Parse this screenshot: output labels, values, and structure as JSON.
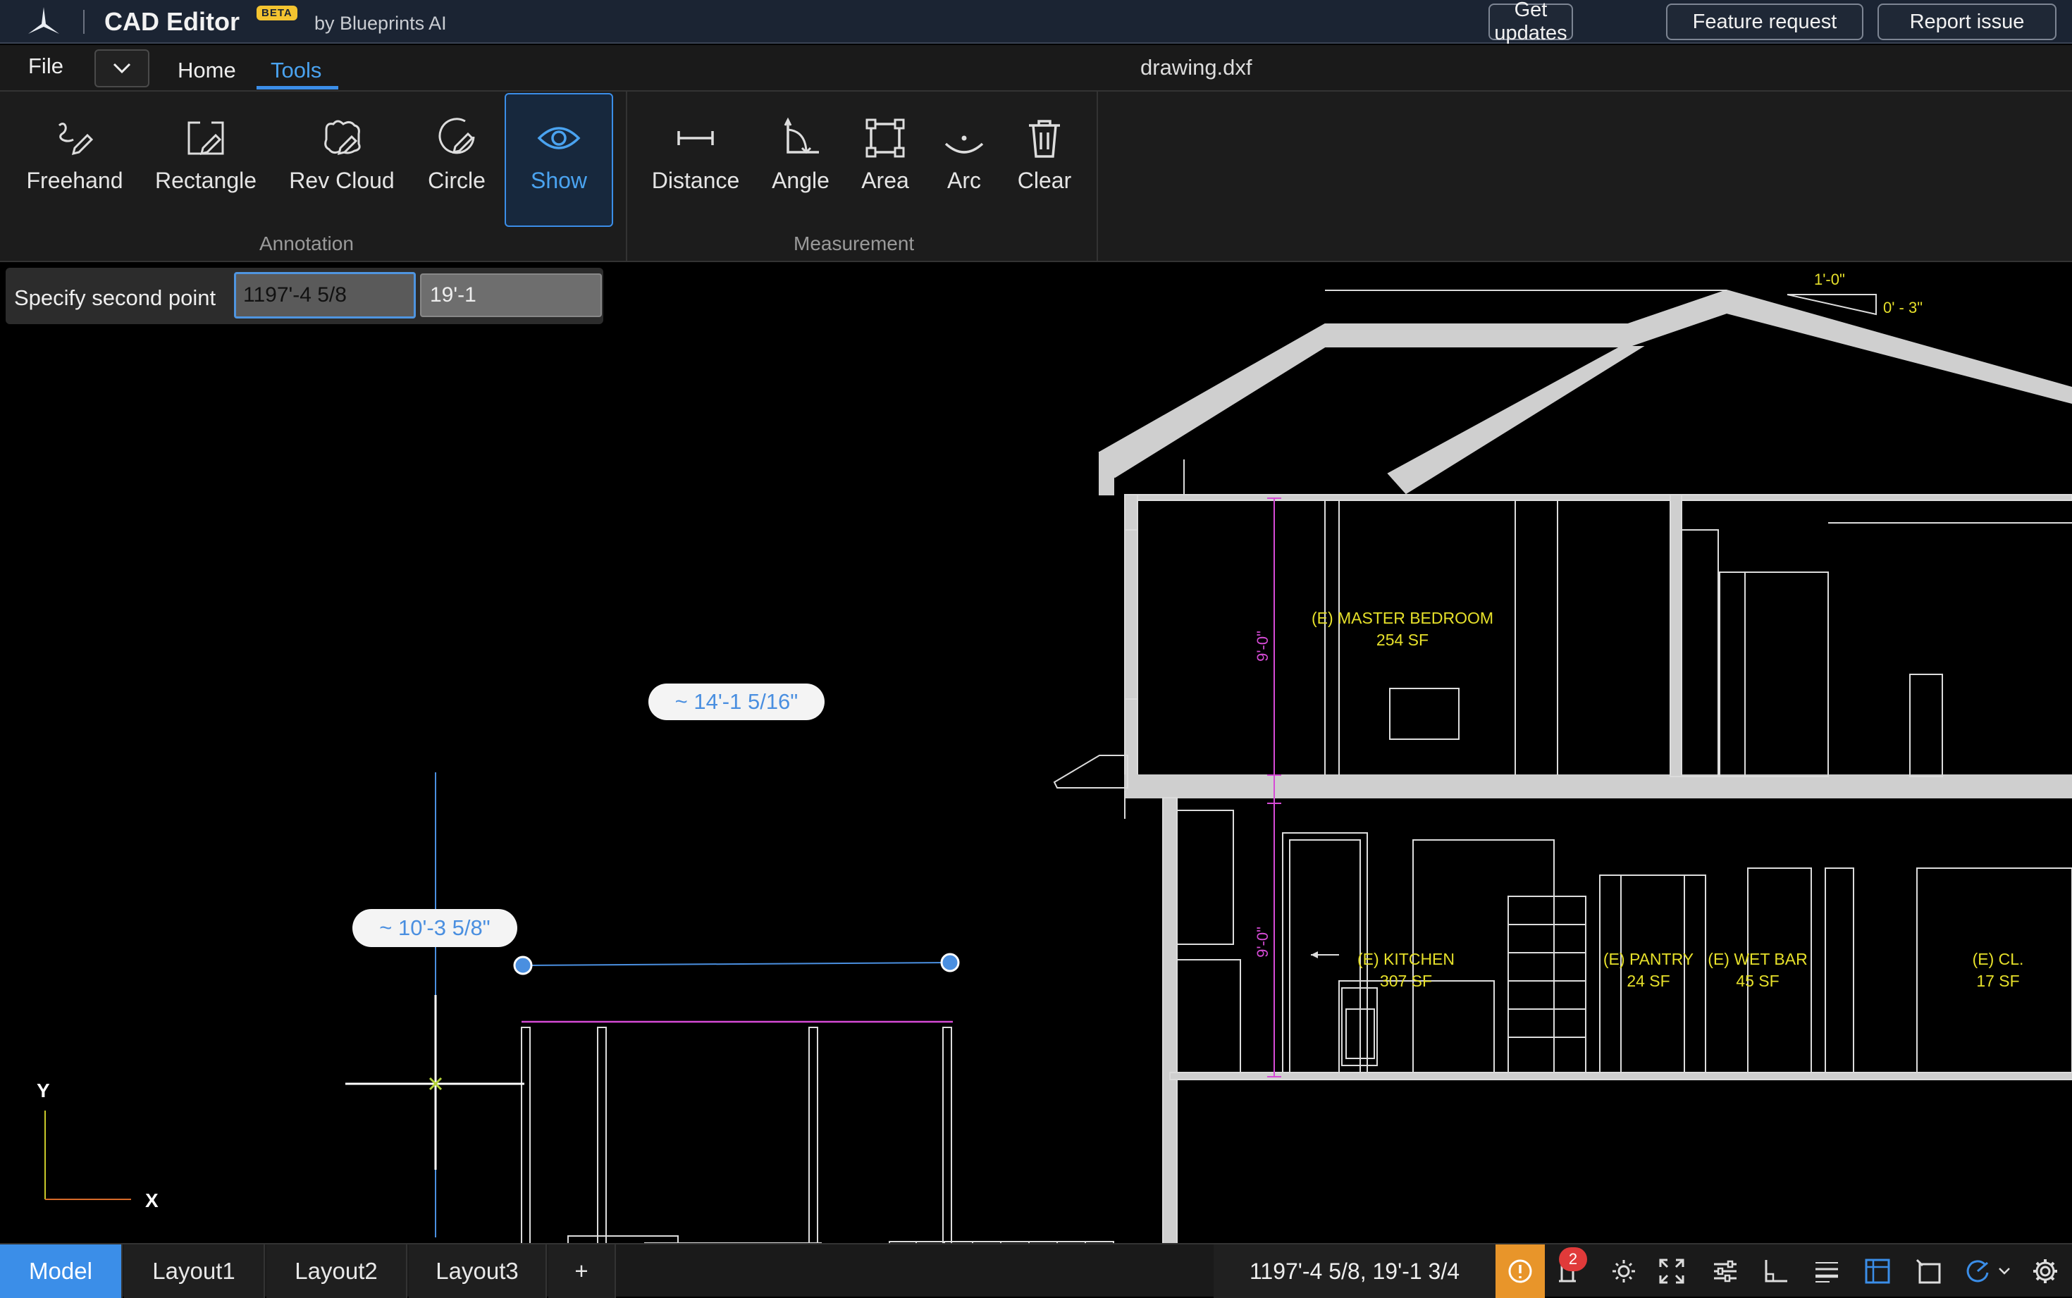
{
  "header": {
    "app_title": "CAD Editor",
    "beta_badge": "BETA",
    "byline": "by Blueprints AI",
    "buttons": {
      "get_updates": "Get updates",
      "feature_request": "Feature request",
      "report_issue": "Report issue"
    }
  },
  "menu": {
    "file": "File",
    "tabs": [
      {
        "label": "Home",
        "active": false
      },
      {
        "label": "Tools",
        "active": true
      }
    ],
    "filename": "drawing.dxf"
  },
  "ribbon": {
    "annotation": {
      "group_label": "Annotation",
      "tools": [
        {
          "label": "Freehand",
          "icon": "freehand-icon"
        },
        {
          "label": "Rectangle",
          "icon": "rectangle-icon"
        },
        {
          "label": "Rev Cloud",
          "icon": "rev-cloud-icon"
        },
        {
          "label": "Circle",
          "icon": "circle-icon"
        },
        {
          "label": "Show",
          "icon": "eye-icon",
          "active": true
        }
      ]
    },
    "measurement": {
      "group_label": "Measurement",
      "tools": [
        {
          "label": "Distance",
          "icon": "distance-icon"
        },
        {
          "label": "Angle",
          "icon": "angle-icon"
        },
        {
          "label": "Area",
          "icon": "area-icon"
        },
        {
          "label": "Arc",
          "icon": "arc-icon"
        },
        {
          "label": "Clear",
          "icon": "trash-icon"
        }
      ]
    }
  },
  "command": {
    "prompt": "Specify second point",
    "x_value": "1197'-4 5/8",
    "y_value": "19'-1"
  },
  "drawing": {
    "measure_distance": "~ 14'-1 5/16\"",
    "measure_height": "~ 10'-3 5/8\"",
    "slope_run": "1'-0\"",
    "slope_rise": "0' - 3\"",
    "dim_upper": "9'-0\"",
    "dim_lower": "9'-0\"",
    "rooms": {
      "master_bedroom": {
        "name": "(E) MASTER BEDROOM",
        "area": "254 SF"
      },
      "kitchen": {
        "name": "(E) KITCHEN",
        "area": "307 SF"
      },
      "pantry": {
        "name": "(E) PANTRY",
        "area": "24 SF"
      },
      "wet_bar": {
        "name": "(E) WET BAR",
        "area": "45 SF"
      },
      "closet": {
        "name": "(E) CL.",
        "area": "17 SF"
      }
    },
    "ucs": {
      "y": "Y",
      "x": "X"
    }
  },
  "colors": {
    "accent": "#3b8ee8",
    "room_label": "#e6e02a",
    "dimension": "#d64bd6",
    "warning": "#e8952a"
  },
  "statusbar": {
    "layout_tabs": [
      "Model",
      "Layout1",
      "Layout2",
      "Layout3"
    ],
    "active_tab": "Model",
    "add_tab": "+",
    "coordinates": "1197'-4 5/8, 19'-1 3/4",
    "notification_count": "2"
  }
}
